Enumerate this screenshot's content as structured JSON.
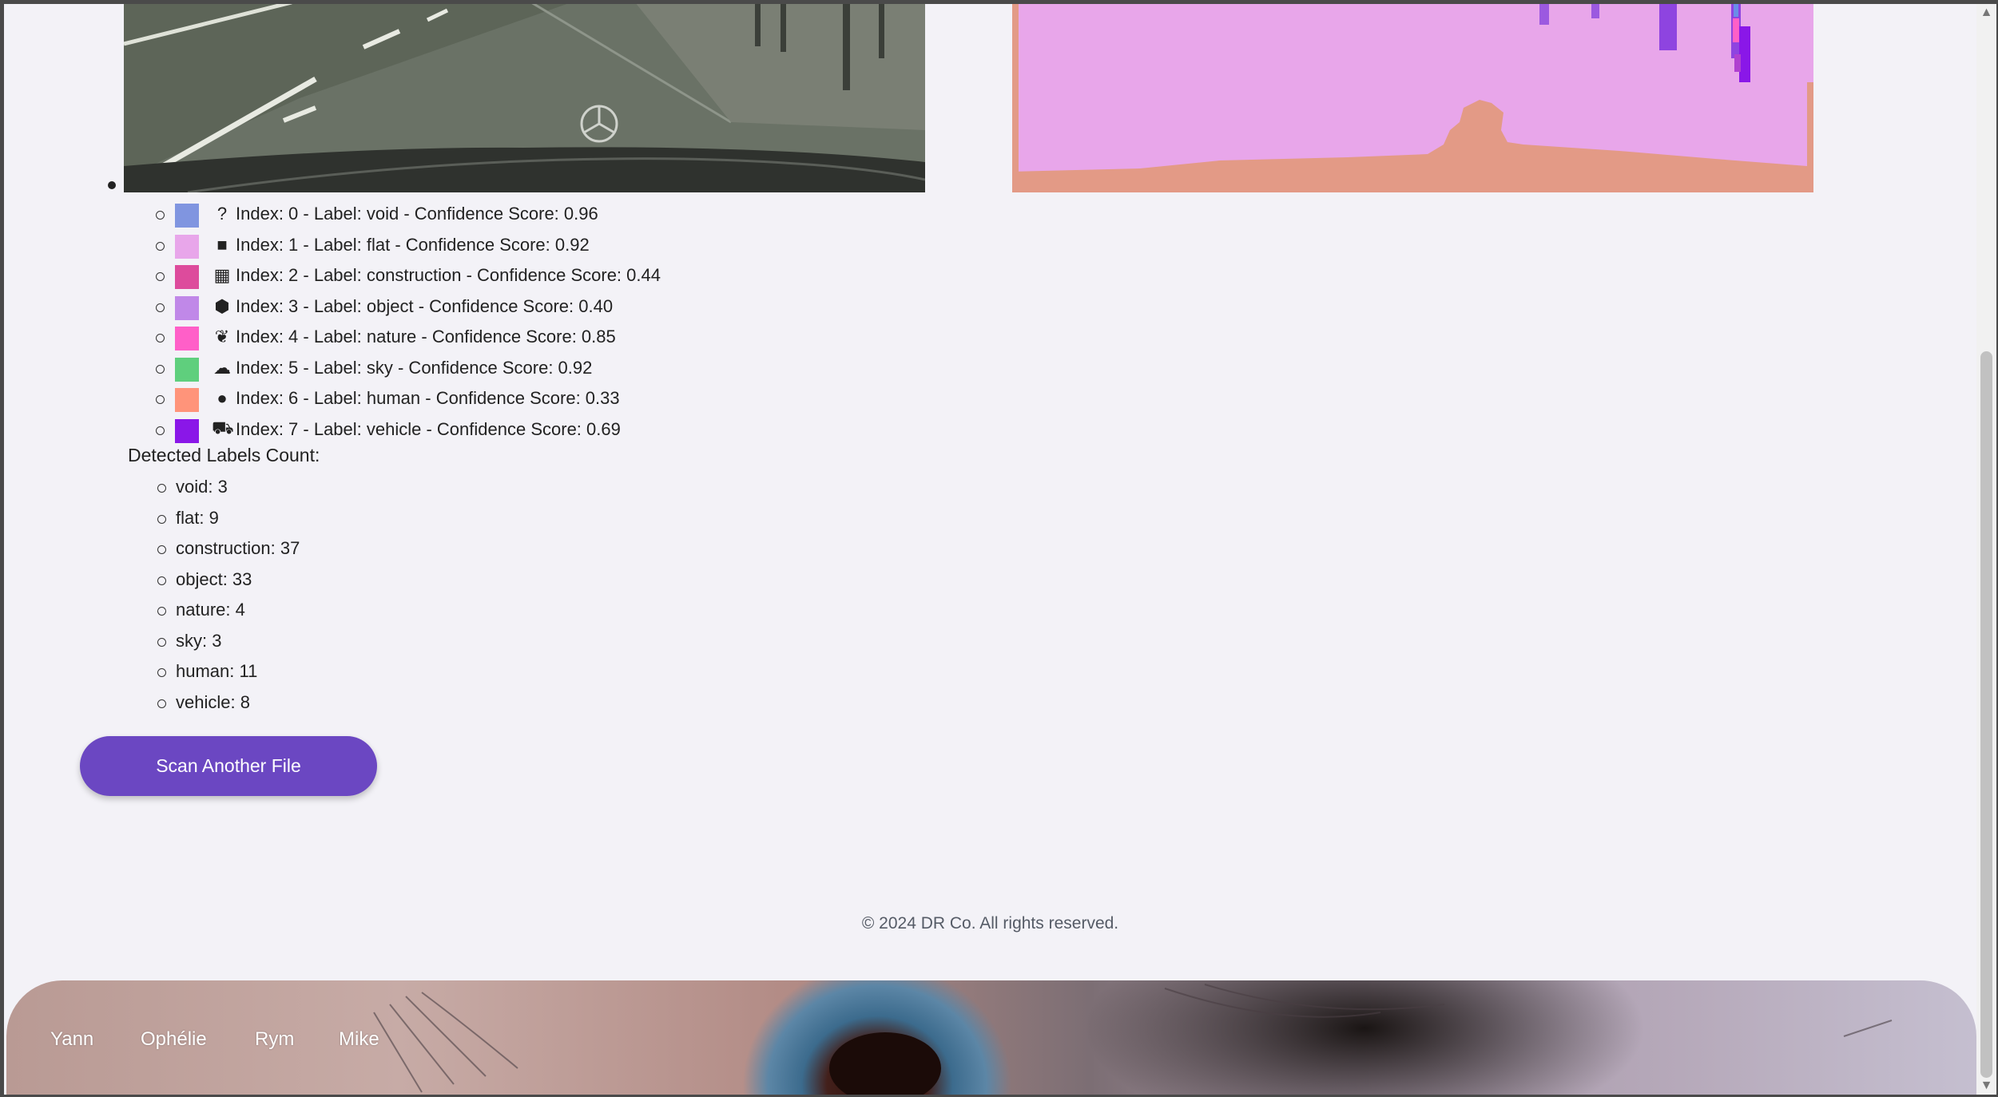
{
  "legend": [
    {
      "icon": "question-icon",
      "glyph": "?",
      "color": "#8095e0",
      "text": "Index: 0 - Label: void - Confidence Score: 0.96"
    },
    {
      "icon": "square-icon",
      "glyph": "■",
      "color": "#e8a6ea",
      "text": "Index: 1 - Label: flat - Confidence Score: 0.92"
    },
    {
      "icon": "building-icon",
      "glyph": "▦",
      "color": "#dd4b9c",
      "text": "Index: 2 - Label: construction - Confidence Score: 0.44"
    },
    {
      "icon": "cube-icon",
      "glyph": "⬢",
      "color": "#c088e8",
      "text": "Index: 3 - Label: object - Confidence Score: 0.40"
    },
    {
      "icon": "leaf-icon",
      "glyph": "❦",
      "color": "#ff5fc8",
      "text": "Index: 4 - Label: nature - Confidence Score: 0.85"
    },
    {
      "icon": "cloud-icon",
      "glyph": "☁",
      "color": "#5fcf7d",
      "text": "Index: 5 - Label: sky - Confidence Score: 0.92"
    },
    {
      "icon": "user-icon",
      "glyph": "👤",
      "color": "#ff947a",
      "text": "Index: 6 - Label: human - Confidence Score: 0.33"
    },
    {
      "icon": "car-icon",
      "glyph": "🚘",
      "color": "#8a17e8",
      "text": "Index: 7 - Label: vehicle - Confidence Score: 0.69"
    }
  ],
  "counts_title": "Detected Labels Count:",
  "counts": [
    "void: 3",
    "flat: 9",
    "construction: 37",
    "object: 33",
    "nature: 4",
    "sky: 3",
    "human: 11",
    "vehicle: 8"
  ],
  "scan_button": "Scan Another File",
  "copyright": "© 2024 DR Co. All rights reserved.",
  "footer_links": [
    "Yann",
    "Ophélie",
    "Rym",
    "Mike"
  ]
}
